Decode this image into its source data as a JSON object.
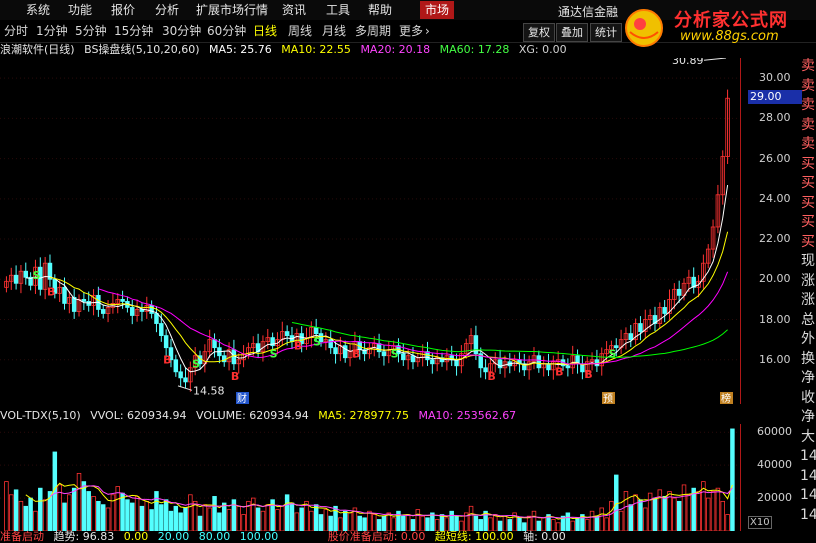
{
  "menu": {
    "items": [
      "系统",
      "功能",
      "报价",
      "分析",
      "扩展市场行情",
      "资讯",
      "工具",
      "帮助"
    ],
    "market": "市场",
    "broker": "通达信金融"
  },
  "periods": {
    "items": [
      "分时",
      "1分钟",
      "5分钟",
      "15分钟",
      "30分钟",
      "60分钟",
      "日线",
      "周线",
      "月线",
      "多周期",
      "更多"
    ],
    "active": "日线"
  },
  "right_buttons": [
    "复权",
    "叠加",
    "统计"
  ],
  "watermark": {
    "title": "分析家公式网",
    "url": "www.88gs.com"
  },
  "info": {
    "stock": "浪潮软件(日线)",
    "formula": "BS操盘线(5,10,20,60)",
    "ma5": "MA5: 25.76",
    "ma10": "MA10: 22.55",
    "ma20": "MA20: 20.18",
    "ma60": "MA60: 17.28",
    "xg": "XG: 0.00"
  },
  "vol_info": {
    "name": "VOL-TDX(5,10)",
    "vvol": "VVOL: 620934.94",
    "volume": "VOLUME: 620934.94",
    "ma5": "MA5: 278977.75",
    "ma10": "MA10: 253562.67"
  },
  "bottom": {
    "a": "准备启动",
    "b": "趋势: 96.83",
    "c": "0.00",
    "d": "20.00",
    "e": "80.00",
    "f": "100.00",
    "g": "股价准备启动: 0.00",
    "h": "超短线: 100.00",
    "i": "轴: 0.00"
  },
  "price_axis": {
    "labels": [
      "30.00",
      "28.00",
      "26.00",
      "24.00",
      "22.00",
      "20.00",
      "18.00",
      "16.00"
    ],
    "current": "29.00"
  },
  "vol_axis": {
    "labels": [
      "60000",
      "40000",
      "20000"
    ],
    "unit": "X10"
  },
  "annotations": {
    "high": "30.89",
    "low": "14.58",
    "badge_cai": "财",
    "badge_yu": "预",
    "badge_bang": "榜"
  },
  "sidebar": [
    "卖",
    "卖",
    "卖",
    "卖",
    "卖",
    "买",
    "买",
    "买",
    "买",
    "买",
    "现",
    "涨",
    "涨",
    "总",
    "外",
    "换",
    "净",
    "收",
    "净",
    "大",
    "14",
    "14",
    "14",
    "14"
  ],
  "colors": {
    "up": "#ff3232",
    "down": "#54ffff",
    "ma5": "#ffffff",
    "ma10": "#ffff00",
    "ma20": "#ff00ff",
    "ma60": "#00ff00",
    "accent": "#b01818"
  },
  "chart_data": {
    "type": "candlestick",
    "ylim": [
      13.8,
      31.0
    ],
    "closes": [
      19.9,
      20.2,
      19.8,
      20.4,
      20.1,
      19.7,
      20.6,
      19.5,
      20.8,
      20.0,
      19.3,
      19.6,
      18.8,
      19.1,
      18.4,
      19.0,
      18.9,
      18.7,
      19.2,
      18.5,
      18.3,
      18.6,
      18.8,
      19.0,
      18.9,
      18.6,
      18.2,
      18.5,
      18.4,
      18.7,
      18.3,
      17.8,
      17.2,
      16.6,
      16.0,
      15.4,
      15.1,
      14.9,
      15.6,
      16.2,
      15.8,
      16.4,
      17.0,
      16.6,
      16.2,
      15.9,
      16.5,
      15.8,
      16.0,
      16.3,
      16.6,
      16.8,
      16.4,
      16.9,
      17.1,
      16.7,
      17.0,
      17.4,
      17.2,
      16.9,
      17.3,
      16.8,
      17.1,
      17.6,
      17.3,
      16.9,
      17.0,
      16.6,
      16.3,
      16.7,
      16.1,
      16.4,
      16.9,
      16.5,
      16.3,
      16.6,
      16.8,
      16.4,
      16.2,
      16.5,
      16.7,
      16.3,
      16.0,
      16.2,
      15.9,
      16.1,
      16.4,
      16.0,
      15.8,
      16.1,
      15.9,
      16.2,
      16.0,
      15.7,
      16.3,
      16.8,
      17.2,
      16.3,
      15.6,
      15.4,
      15.8,
      16.0,
      15.6,
      15.9,
      15.7,
      16.0,
      15.8,
      15.5,
      15.9,
      16.2,
      15.6,
      15.8,
      15.5,
      15.9,
      16.0,
      15.7,
      15.6,
      16.2,
      15.8,
      15.4,
      15.9,
      16.0,
      15.7,
      16.3,
      16.5,
      16.7,
      16.6,
      17.0,
      17.3,
      17.0,
      17.8,
      17.4,
      18.0,
      18.2,
      17.8,
      18.6,
      18.3,
      19.0,
      19.5,
      19.2,
      19.8,
      20.1,
      19.6,
      19.9,
      20.8,
      21.5,
      22.6,
      24.2,
      26.1,
      29.0
    ],
    "volumes": [
      30000,
      22000,
      25000,
      18000,
      15000,
      20000,
      12000,
      26000,
      19000,
      24000,
      48000,
      28000,
      17000,
      22000,
      26000,
      35000,
      30000,
      24000,
      21000,
      18000,
      16000,
      14000,
      22000,
      27000,
      23000,
      19000,
      17000,
      21000,
      15000,
      18000,
      13000,
      24000,
      16000,
      19000,
      12000,
      15000,
      11000,
      14000,
      22000,
      18000,
      9000,
      16000,
      14000,
      21000,
      11000,
      17000,
      13000,
      19000,
      15000,
      10000,
      18000,
      20000,
      14000,
      12000,
      16000,
      19000,
      13000,
      15000,
      22000,
      17000,
      11000,
      14000,
      18000,
      12000,
      16000,
      10000,
      13000,
      9000,
      15000,
      8000,
      12000,
      11000,
      14000,
      9000,
      8000,
      12000,
      10000,
      7000,
      9000,
      11000,
      8000,
      12000,
      9000,
      10000,
      7000,
      13000,
      9000,
      8000,
      11000,
      7000,
      10000,
      8000,
      12000,
      9000,
      6000,
      11000,
      15000,
      9000,
      7000,
      12000,
      8000,
      10000,
      6000,
      9000,
      7000,
      11000,
      8000,
      5000,
      9000,
      12000,
      6000,
      8000,
      10000,
      7000,
      5000,
      9000,
      11000,
      6000,
      8000,
      10000,
      7000,
      12000,
      9000,
      14000,
      8000,
      18000,
      34000,
      12000,
      24000,
      16000,
      22000,
      19000,
      14000,
      23000,
      20000,
      25000,
      21000,
      24000,
      20000,
      18000,
      28000,
      22000,
      26000,
      24000,
      30000,
      20000,
      24000,
      26000,
      18000,
      10000,
      62000
    ]
  }
}
